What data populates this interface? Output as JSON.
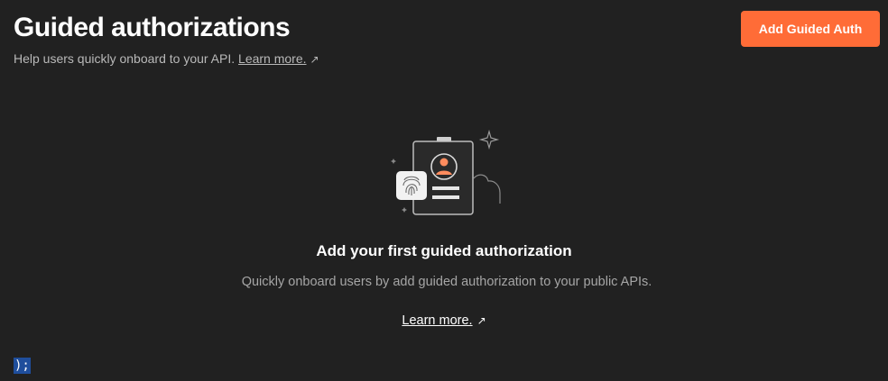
{
  "header": {
    "title": "Guided authorizations",
    "subtitle": "Help users quickly onboard to your API.",
    "learn_more_label": "Learn more.",
    "external_icon": "external-link-arrow-icon"
  },
  "actions": {
    "add_button_label": "Add Guided Auth"
  },
  "empty_state": {
    "illustration_icon": "id-badge-fingerprint-illustration",
    "title": "Add your first guided authorization",
    "description": "Quickly onboard users by add guided authorization to your public APIs.",
    "learn_more_label": "Learn more."
  },
  "fragment": {
    "text": ");"
  },
  "colors": {
    "background": "#212121",
    "accent": "#ff6c37",
    "muted_text": "#b9b9b9",
    "selection": "#1f4e9c"
  }
}
